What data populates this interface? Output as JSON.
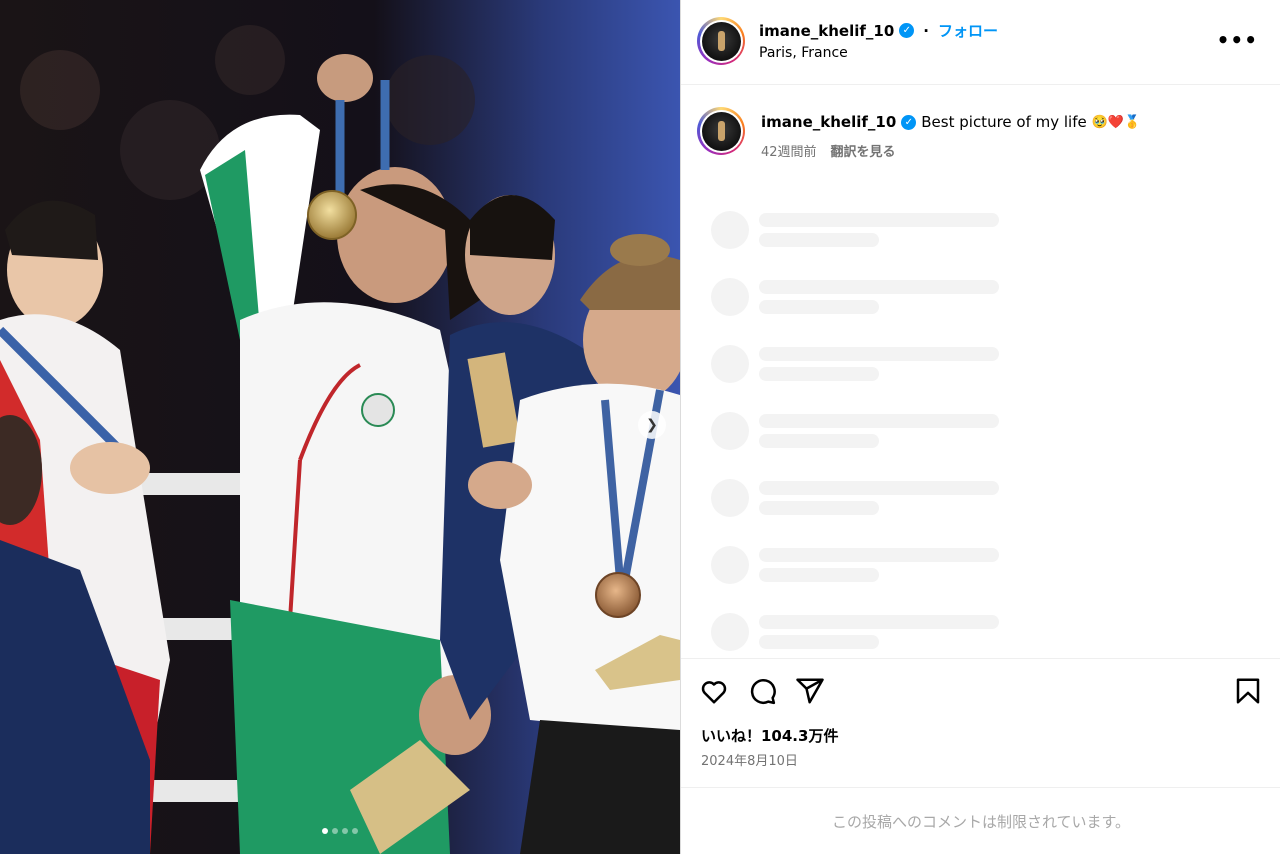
{
  "post": {
    "username": "imane_khelif_10",
    "follow_label": "フォロー",
    "location": "Paris, France",
    "more_label": "•••",
    "caption_text": "Best picture of my life",
    "caption_emojis": "🥹❤️🥇",
    "time_ago": "42週間前",
    "translate_label": "翻訳を見る",
    "likes": "いいね！104.3万件",
    "date": "2024年8月10日",
    "comments_restricted": "この投稿へのコメントは制限されています。"
  },
  "icons": {
    "verified": "verified-badge-icon",
    "like": "heart-icon",
    "comment": "comment-bubble-icon",
    "share": "paper-plane-icon",
    "save": "bookmark-icon",
    "next": "chevron-right-icon"
  },
  "carousel": {
    "slide_count": 4,
    "active_index": 0
  },
  "colors": {
    "accent": "#0095f6",
    "muted": "#737373",
    "skeleton": "#f3f3f3"
  }
}
